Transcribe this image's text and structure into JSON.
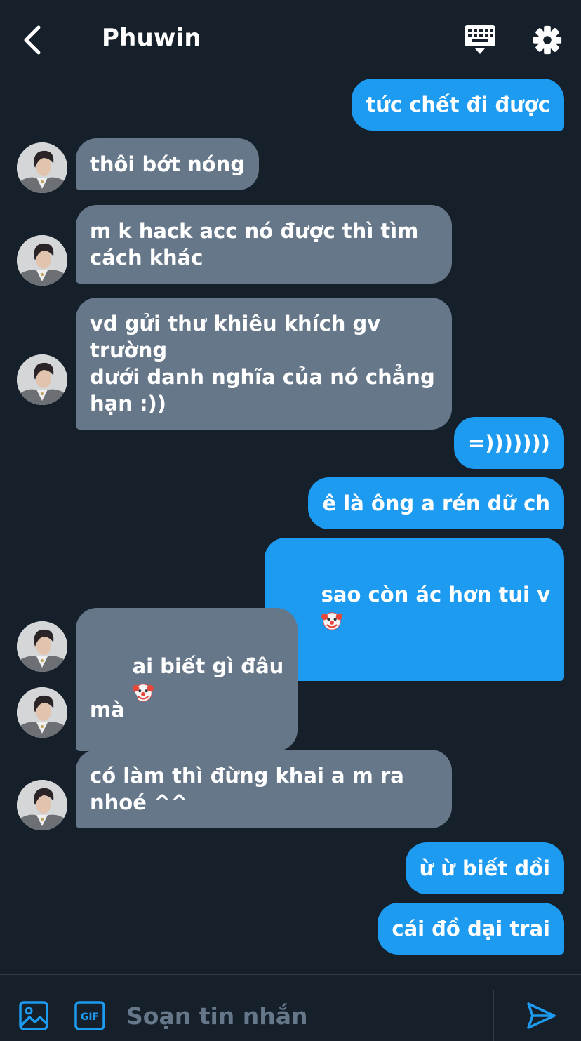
{
  "header": {
    "title": "Phuwin",
    "back_icon": "chevron-left-icon",
    "keyboard_icon": "keyboard-icon",
    "settings_icon": "gear-icon"
  },
  "messages": [
    {
      "from": "me",
      "text": "tức chết đi được"
    },
    {
      "from": "them",
      "text": "thôi bớt nóng"
    },
    {
      "from": "them",
      "text": "m k hack acc nó được thì tìm\ncách khác"
    },
    {
      "from": "them",
      "text": "vd gửi thư khiêu khích gv trường\ndưới danh nghĩa của nó chẳng\nhạn :))"
    },
    {
      "from": "me",
      "text": "=)))))))"
    },
    {
      "from": "me",
      "text": "ê là ông a rén dữ ch"
    },
    {
      "from": "me",
      "text": "sao còn ác hơn tui v",
      "emoji": "clown-face-emoji"
    },
    {
      "from": "them",
      "text": "ai biết gì đâu",
      "emoji": "clown-face-emoji"
    },
    {
      "from": "them",
      "text": "mà"
    },
    {
      "from": "them",
      "text": "có làm thì đừng khai a m ra\nnhoé ^^"
    },
    {
      "from": "me",
      "text": "ừ ừ biết dồi"
    },
    {
      "from": "me",
      "text": "cái đồ dại trai"
    }
  ],
  "composer": {
    "placeholder": "Soạn tin nhắn",
    "value": "",
    "image_icon": "image-icon",
    "gif_icon": "gif-icon",
    "gif_label": "GIF",
    "send_icon": "send-icon"
  },
  "colors": {
    "background": "#15202b",
    "outgoing_bubble": "#1d9bf0",
    "incoming_bubble": "#66778a",
    "accent": "#1d9bf0"
  }
}
